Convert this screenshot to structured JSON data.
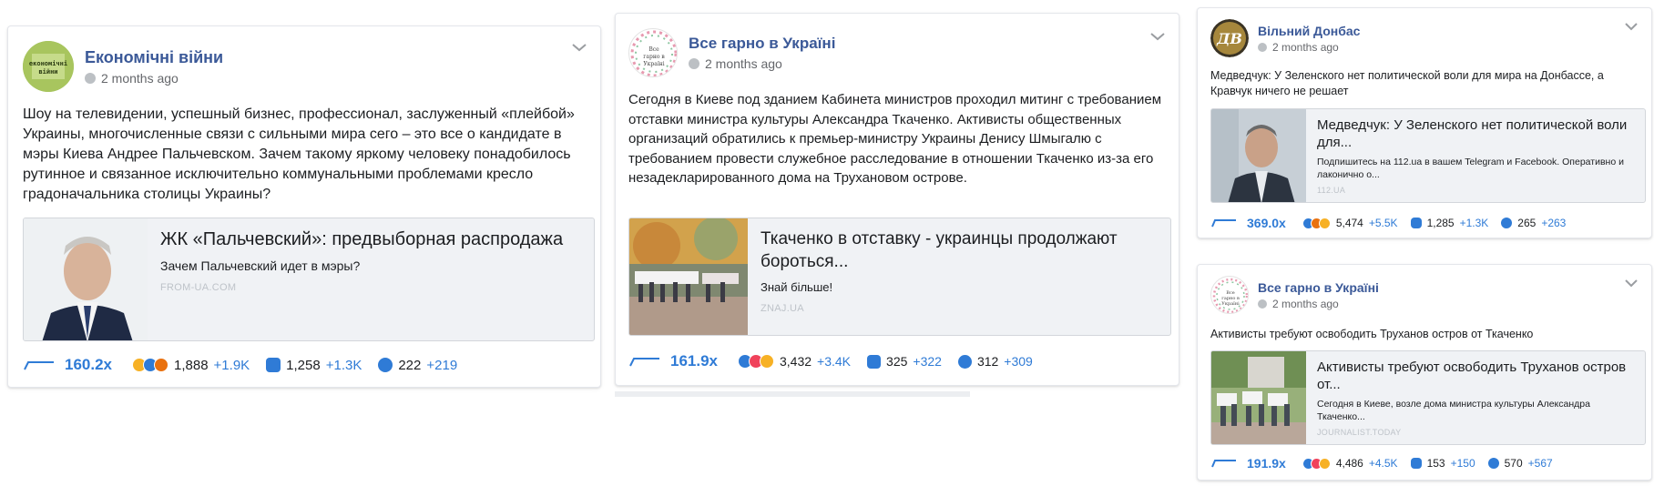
{
  "posts": [
    {
      "page_name": "Економічні війни",
      "avatar_text": "Економічні війни",
      "time": "2 months ago",
      "text": "Шоу на телевидении, успешный бизнес, профессионал, заслуженный «плейбой» Украины, многочисленные связи с сильными мира сего – это все о кандидате в мэры Киева Андрее Пальчевском. Зачем такому яркому человеку понадобилось рутинное и связанное исключительно коммунальными проблемами кресло градоначальника столицы Украины?",
      "link": {
        "title": "ЖК «Пальчевский»: предвыборная распродажа",
        "description": "Зачем Пальчевский идет в мэры?",
        "domain": "FROM-UA.COM"
      },
      "overperformance": "160.2x",
      "reactions": "1,888",
      "reactions_delta": "+1.9K",
      "comments": "1,258",
      "comments_delta": "+1.3K",
      "shares": "222",
      "shares_delta": "+219"
    },
    {
      "page_name": "Все гарно в Україні",
      "avatar_text": "Все гарно в Україні",
      "time": "2 months ago",
      "text": "Сегодня в Киеве под зданием Кабинета министров проходил митинг с требованием отставки министра культуры Александра Ткаченко. Активисты общественных организаций обратились к премьер-министру Украины Денису Шмыгалю с требованием провести служебное расследование в отношении Ткаченко из-за его незадекларированного дома на Трухановом острове.",
      "link": {
        "title": "Ткаченко в отставку - украинцы продолжают бороться...",
        "description": "Знай більше!",
        "domain": "ZNAJ.UA"
      },
      "overperformance": "161.9x",
      "reactions": "3,432",
      "reactions_delta": "+3.4K",
      "comments": "325",
      "comments_delta": "+322",
      "shares": "312",
      "shares_delta": "+309"
    },
    {
      "page_name": "Вільний Донбас",
      "avatar_text": "ДВ",
      "time": "2 months ago",
      "text": "Медведчук: У Зеленского нет политической воли для мира на Донбассе, а Кравчук ничего не решает",
      "link": {
        "title": "Медведчук: У Зеленского нет политической воли для...",
        "description": "Подпишитесь на 112.ua в вашем Telegram и Facebook. Оперативно и лаконично о...",
        "domain": "112.UA"
      },
      "overperformance": "369.0x",
      "reactions": "5,474",
      "reactions_delta": "+5.5K",
      "comments": "1,285",
      "comments_delta": "+1.3K",
      "shares": "265",
      "shares_delta": "+263"
    },
    {
      "page_name": "Все гарно в Україні",
      "avatar_text": "Все гарно в Україні",
      "time": "2 months ago",
      "text": "Активисты требуют освободить Труханов остров от Ткаченко",
      "link": {
        "title": "Активисты требуют освободить Труханов остров от...",
        "description": "Сегодня в Киеве, возле дома министра культуры Александра Ткаченко...",
        "domain": "JOURNALIST.TODAY"
      },
      "overperformance": "191.9x",
      "reactions": "4,486",
      "reactions_delta": "+4.5K",
      "comments": "153",
      "comments_delta": "+150",
      "shares": "570",
      "shares_delta": "+567"
    }
  ],
  "colors": {
    "link_blue": "#3b5998",
    "accent_blue": "#2f7bd6",
    "muted": "#65676b"
  }
}
